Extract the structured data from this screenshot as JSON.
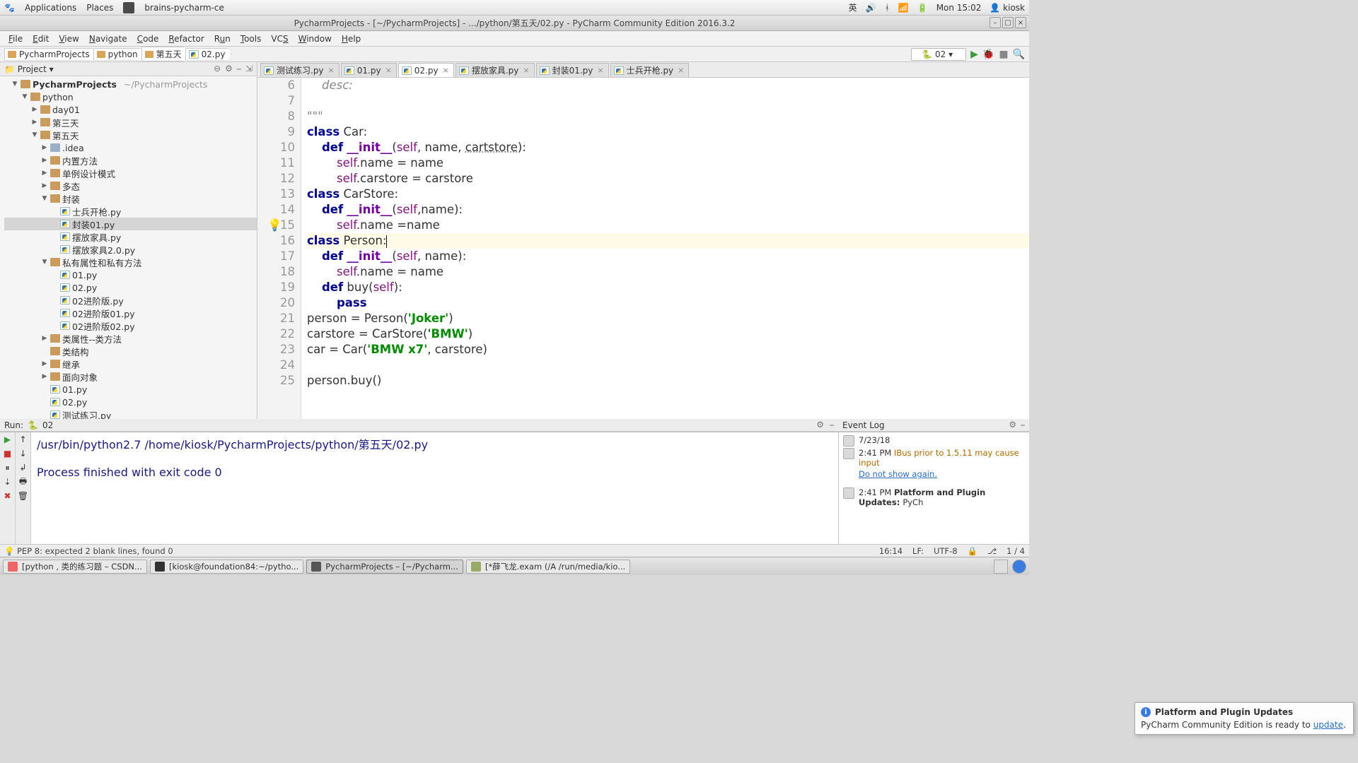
{
  "gnome": {
    "applications": "Applications",
    "places": "Places",
    "taskname": "brains-pycharm-ce",
    "lang": "英",
    "datetime": "Mon 15:02",
    "user": "kiosk"
  },
  "window": {
    "title": "PycharmProjects - [~/PycharmProjects] - .../python/第五天/02.py - PyCharm Community Edition 2016.3.2"
  },
  "menu": [
    "File",
    "Edit",
    "View",
    "Navigate",
    "Code",
    "Refactor",
    "Run",
    "Tools",
    "VCS",
    "Window",
    "Help"
  ],
  "breadcrumbs": [
    "PycharmProjects",
    "python",
    "第五天",
    "02.py"
  ],
  "run_config": {
    "name": "02"
  },
  "project_header": "Project",
  "tree": {
    "root": "PycharmProjects",
    "root_path": "~/PycharmProjects",
    "n1": "python",
    "n2": "day01",
    "n3": "第三天",
    "n4": "第五天",
    "n5": ".idea",
    "n6": "内置方法",
    "n7": "单例设计模式",
    "n8": "多态",
    "n9": "封装",
    "f1": "士兵开枪.py",
    "f2": "封装01.py",
    "f3": "摆放家具.py",
    "f4": "摆放家具2.0.py",
    "n10": "私有属性和私有方法",
    "f5": "01.py",
    "f6": "02.py",
    "f7": "02进阶版.py",
    "f8": "02进阶版01.py",
    "f9": "02进阶版02.py",
    "n11": "类属性--类方法",
    "n12": "类结构",
    "n13": "继承",
    "n14": "面向对象",
    "f10": "01.py",
    "f11": "02.py",
    "f12": "测试练习.py"
  },
  "tabs": [
    "测试练习.py",
    "01.py",
    "02.py",
    "摆放家具.py",
    "封装01.py",
    "士兵开枪.py"
  ],
  "active_tab": "02.py",
  "gutter_start": 6,
  "gutter_end": 25,
  "code": {
    "l6": "    desc:",
    "l7": "",
    "l8": "\"\"\"",
    "l9": {
      "pre": "",
      "kw": "class",
      "post": " Car:"
    },
    "l10": {
      "indent": "    ",
      "kw": "def",
      "sp": " ",
      "fn": "__init__",
      "args": "(",
      "self": "self",
      "rest": ", name, ",
      "p2": "cartstore",
      "end": "):"
    },
    "l11": {
      "indent": "        ",
      "self": "self",
      "rest": ".name = name"
    },
    "l12": {
      "indent": "        ",
      "self": "self",
      "rest": ".carstore = carstore"
    },
    "l13": {
      "kw": "class",
      "post": " CarStore:"
    },
    "l14": {
      "indent": "    ",
      "kw": "def",
      "sp": " ",
      "fn": "__init__",
      "args": "(",
      "self": "self",
      "rest": ",name):"
    },
    "l15": {
      "indent": "        ",
      "self": "self",
      "rest": ".name =name"
    },
    "l16": {
      "kw": "class",
      "post": " Person:"
    },
    "l17": {
      "indent": "    ",
      "kw": "def",
      "sp": " ",
      "fn": "__init__",
      "args": "(",
      "self": "self",
      "rest": ", name):"
    },
    "l18": {
      "indent": "        ",
      "self": "self",
      "rest": ".name = name"
    },
    "l19": {
      "indent": "    ",
      "kw": "def",
      "sp": " ",
      "fn2": "buy",
      "args": "(",
      "self": "self",
      "rest": "):"
    },
    "l20": {
      "indent": "        ",
      "kw": "pass"
    },
    "l21": {
      "a": "person = Person(",
      "s": "'Joker'",
      "b": ")"
    },
    "l22": {
      "a": "carstore = CarStore(",
      "s": "'BMW'",
      "b": ")"
    },
    "l23": {
      "a": "car = Car(",
      "s": "'BMW x7'",
      "b": ", carstore)"
    },
    "l24": "",
    "l25": "person.buy()"
  },
  "run": {
    "label": "Run:",
    "config": "02",
    "cmd": "/usr/bin/python2.7 /home/kiosk/PycharmProjects/python/第五天/02.py",
    "result": "Process finished with exit code 0"
  },
  "eventlog": {
    "title": "Event Log",
    "date": "7/23/18",
    "r1_time": "2:41 PM",
    "r1_msg": "IBus prior to 1.5.11 may cause input",
    "r1_link": "Do not show again.",
    "r2_time": "2:41 PM",
    "r2_msg": "Platform and Plugin Updates: ",
    "r2_tail": "PyCh"
  },
  "popup": {
    "title": "Platform and Plugin Updates",
    "msg_a": "PyCharm Community Edition is ready to ",
    "link": "update",
    "msg_b": "."
  },
  "status": {
    "msg": "PEP 8: expected 2 blank lines, found 0",
    "pos": "16:14",
    "lf": "LF:",
    "enc": "UTF-8",
    "ctx": "1 / 4"
  },
  "taskbar": {
    "t1": "[python , 类的练习题 – CSDN...",
    "t2": "[kiosk@foundation84:~/pytho...",
    "t3": "PycharmProjects – [~/Pycharm...",
    "t4": "[*薛飞龙.exam (/A /run/media/kio..."
  }
}
